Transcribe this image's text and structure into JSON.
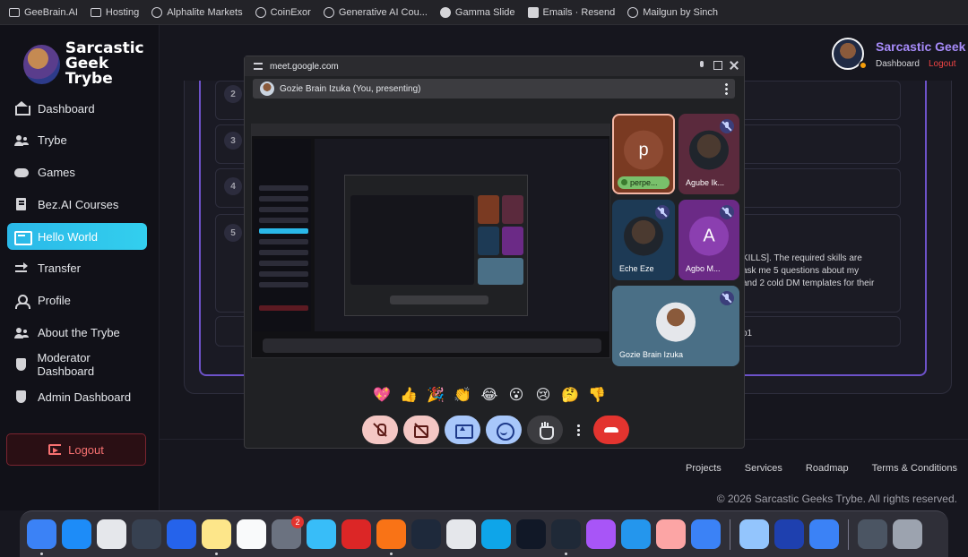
{
  "bookmarks": [
    {
      "label": "GeeBrain.AI",
      "icon": "folder-icon"
    },
    {
      "label": "Hosting",
      "icon": "folder-icon"
    },
    {
      "label": "Alphalite Markets",
      "icon": "globe-icon"
    },
    {
      "label": "CoinExor",
      "icon": "globe-icon"
    },
    {
      "label": "Generative AI Cou...",
      "icon": "globe-icon"
    },
    {
      "label": "Gamma Slide",
      "icon": "gamma-icon"
    },
    {
      "label": "Emails · Resend",
      "icon": "resend-icon"
    },
    {
      "label": "Mailgun by Sinch",
      "icon": "globe-icon"
    }
  ],
  "sidebar": {
    "brand": {
      "line1": "Sarcastic",
      "line2": "Geek Trybe"
    },
    "items": [
      {
        "label": "Dashboard",
        "icon": "home-icon",
        "active": false
      },
      {
        "label": "Trybe",
        "icon": "users-icon",
        "active": false
      },
      {
        "label": "Games",
        "icon": "gamepad-icon",
        "active": false
      },
      {
        "label": "Bez.AI Courses",
        "icon": "book-icon",
        "active": false
      },
      {
        "label": "Hello World",
        "icon": "terminal-icon",
        "active": true
      },
      {
        "label": "Transfer",
        "icon": "transfer-icon",
        "active": false
      },
      {
        "label": "Profile",
        "icon": "profile-icon",
        "active": false
      },
      {
        "label": "About the Trybe",
        "icon": "users-icon",
        "active": false
      },
      {
        "label": "Moderator Dashboard",
        "icon": "shield-icon",
        "active": false
      },
      {
        "label": "Admin Dashboard",
        "icon": "shield-icon",
        "active": false
      }
    ],
    "logout_label": "Logout"
  },
  "header": {
    "user_name": "Sarcastic Geek",
    "dashboard_link": "Dashboard",
    "logout_link": "Logout"
  },
  "content": {
    "row_numbers": [
      "2",
      "3",
      "4",
      "5"
    ],
    "visible_lines": [
      "KILLS]. The required skills are",
      "ask me 5 questions about my",
      "and 2 cold DM templates for their"
    ],
    "visible_tail": "p1"
  },
  "footer": {
    "links": [
      "Projects",
      "Services",
      "Roadmap",
      "Terms & Conditions"
    ],
    "copyright": "© 2026 Sarcastic Geeks Trybe. All rights reserved."
  },
  "meet": {
    "url": "meet.google.com",
    "presenter": "Gozie Brain Izuka (You, presenting)",
    "participants": [
      {
        "name": "perpe...",
        "initial": "p",
        "tile_color": "#7a3a22",
        "muted": false,
        "speaking": true
      },
      {
        "name": "Agube Ik...",
        "initial": "",
        "tile_color": "#5b2a3d",
        "muted": true,
        "speaking": false
      },
      {
        "name": "Eche Eze",
        "initial": "",
        "tile_color": "#1d3a55",
        "muted": true,
        "speaking": false
      },
      {
        "name": "Agbo M...",
        "initial": "A",
        "tile_color": "#6b2a86",
        "muted": true,
        "speaking": false
      },
      {
        "name": "Gozie Brain Izuka",
        "initial": "",
        "tile_color": "#4a6f86",
        "muted": true,
        "speaking": false
      }
    ],
    "reactions": [
      "💖",
      "👍",
      "🎉",
      "👏",
      "😂",
      "😮",
      "😢",
      "🤔",
      "👎"
    ],
    "controls": [
      {
        "name": "mic-off-button",
        "icon": "micoff"
      },
      {
        "name": "camera-off-button",
        "icon": "camoff"
      },
      {
        "name": "present-button",
        "icon": "present"
      },
      {
        "name": "reactions-button",
        "icon": "emoji"
      },
      {
        "name": "raise-hand-button",
        "icon": "hand"
      },
      {
        "name": "more-options-button",
        "icon": "dots"
      },
      {
        "name": "leave-call-button",
        "icon": "phone"
      }
    ]
  },
  "dock": {
    "apps": [
      {
        "name": "finder-icon",
        "color": "#3b82f6"
      },
      {
        "name": "app-store-icon",
        "color": "#1d8cf8"
      },
      {
        "name": "launchpad-icon",
        "color": "#e5e7eb"
      },
      {
        "name": "mission-control-icon",
        "color": "#374151"
      },
      {
        "name": "xcode-icon",
        "color": "#2563eb"
      },
      {
        "name": "notes-icon",
        "color": "#fde68a"
      },
      {
        "name": "notion-icon",
        "color": "#f9fafb"
      },
      {
        "name": "system-settings-icon",
        "color": "#6b7280",
        "badge": "2"
      },
      {
        "name": "safari-icon",
        "color": "#38bdf8"
      },
      {
        "name": "opera-icon",
        "color": "#dc2626"
      },
      {
        "name": "brave-icon",
        "color": "#f97316"
      },
      {
        "name": "arc-icon",
        "color": "#1e293b"
      },
      {
        "name": "calculator-icon",
        "color": "#e5e7eb"
      },
      {
        "name": "vscode-icon",
        "color": "#0ea5e9"
      },
      {
        "name": "terminal-icon",
        "color": "#111827"
      },
      {
        "name": "activity-monitor-icon",
        "color": "#1f2937"
      },
      {
        "name": "github-desktop-icon",
        "color": "#a855f7"
      },
      {
        "name": "docker-icon",
        "color": "#2496ed"
      },
      {
        "name": "usb-drive-icon",
        "color": "#fca5a5"
      },
      {
        "name": "app-store-2-icon",
        "color": "#3b82f6"
      }
    ],
    "recent": [
      {
        "name": "preview-icon",
        "color": "#93c5fd"
      },
      {
        "name": "wordpress-icon",
        "color": "#1e40af"
      },
      {
        "name": "mail-icon",
        "color": "#3b82f6"
      }
    ],
    "trailing": [
      {
        "name": "downloads-icon",
        "color": "#4b5563"
      },
      {
        "name": "trash-icon",
        "color": "#9ca3af"
      }
    ]
  }
}
